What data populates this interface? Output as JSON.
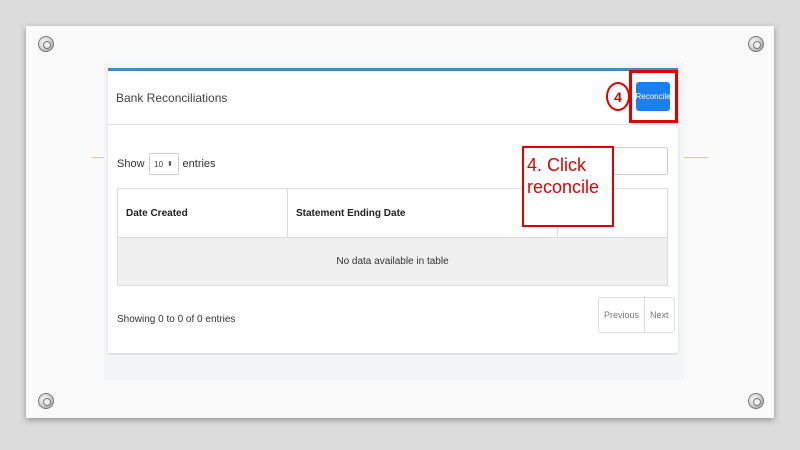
{
  "card": {
    "title": "Bank Reconciliations",
    "reconcile_label": "Reconcile",
    "step_number": "4"
  },
  "length_control": {
    "show_label": "Show",
    "selected_value": "10",
    "entries_label": "entries"
  },
  "table": {
    "headers": [
      "Date Created",
      "Statement Ending Date",
      ""
    ],
    "empty_message": "No data available in table"
  },
  "footer": {
    "info": "Showing 0 to 0 of 0 entries",
    "previous_label": "Previous",
    "next_label": "Next"
  },
  "annotation": {
    "callout_line1": "4. Click",
    "callout_line2": "reconcile",
    "highlight_color": "#e00000"
  },
  "colors": {
    "accent_button": "#1a7ff0",
    "card_top_border": "#3c8dbc"
  }
}
